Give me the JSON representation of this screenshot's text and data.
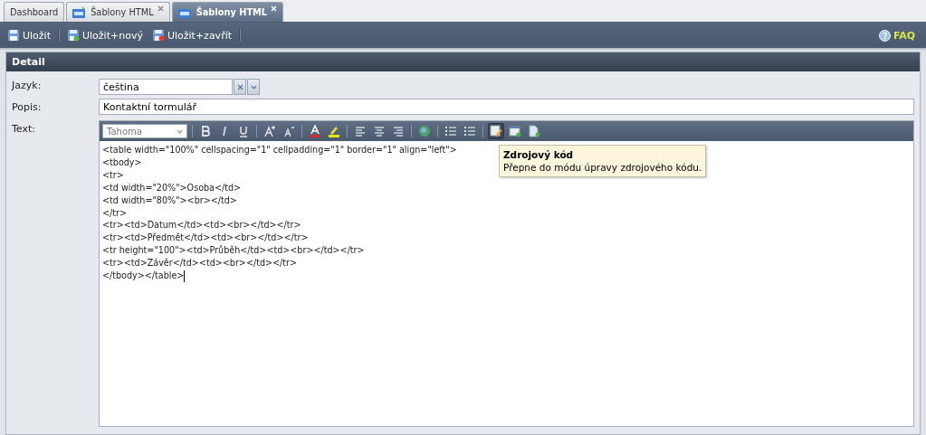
{
  "tabs": [
    {
      "label": "Dashboard",
      "icon": false,
      "closable": false,
      "selected": false
    },
    {
      "label": "Šablony HTML",
      "icon": true,
      "closable": true,
      "selected": false
    },
    {
      "label": "Šablony HTML",
      "icon": true,
      "closable": true,
      "selected": true
    }
  ],
  "toolbar": {
    "buttons": [
      {
        "label": "Uložit",
        "kind": "save"
      },
      {
        "label": "Uložit+nový",
        "kind": "save-new"
      },
      {
        "label": "Uložit+zavřít",
        "kind": "save-close"
      }
    ],
    "help": {
      "label": "FAQ"
    }
  },
  "panel": {
    "title": "Detail",
    "fields": [
      {
        "label": "Jazyk:",
        "kind": "combo",
        "value": "čeština"
      },
      {
        "label": "Popis:",
        "kind": "text",
        "value": "Kontaktní tormulář"
      },
      {
        "label": "Text:",
        "kind": "editor"
      }
    ],
    "editor": {
      "font": {
        "placeholder": "Tahoma"
      },
      "tools": [
        {
          "kind": "bold",
          "selected": false
        },
        {
          "kind": "italic",
          "selected": false
        },
        {
          "kind": "underline",
          "selected": false
        },
        {
          "kind": "sep"
        },
        {
          "kind": "grow",
          "selected": false
        },
        {
          "kind": "shrink",
          "selected": false
        },
        {
          "kind": "sep"
        },
        {
          "kind": "color",
          "selected": false
        },
        {
          "kind": "highlight",
          "selected": false
        },
        {
          "kind": "sep"
        },
        {
          "kind": "left",
          "selected": false
        },
        {
          "kind": "center",
          "selected": false
        },
        {
          "kind": "right",
          "selected": false
        },
        {
          "kind": "sep"
        },
        {
          "kind": "link",
          "selected": false
        },
        {
          "kind": "sep"
        },
        {
          "kind": "ol",
          "selected": false
        },
        {
          "kind": "ul",
          "selected": false
        },
        {
          "kind": "sep"
        },
        {
          "kind": "source",
          "selected": true
        },
        {
          "kind": "insert",
          "selected": false
        },
        {
          "kind": "doc",
          "selected": false
        }
      ],
      "lines": [
        "<table width=\"100%\" cellspacing=\"1\" cellpadding=\"1\" border=\"1\" align=\"left\">",
        "<tbody>",
        "<tr>",
        "<td width=\"20%\">Osoba</td>",
        "<td width=\"80%\"><br></td>",
        "</tr>",
        "<tr><td>Datum</td><td><br></td></tr>",
        "<tr><td>Předmět</td><td><br></td></tr>",
        "<tr height=\"100\"><td>Průběh</td><td><br></td></tr>",
        "<tr><td>Závěr</td><td><br></td></tr>",
        "</tbody></table>"
      ],
      "tooltip": {
        "title": "Zdrojový kód",
        "text": "Přepne do módu úpravy zdrojového kódu."
      }
    }
  }
}
